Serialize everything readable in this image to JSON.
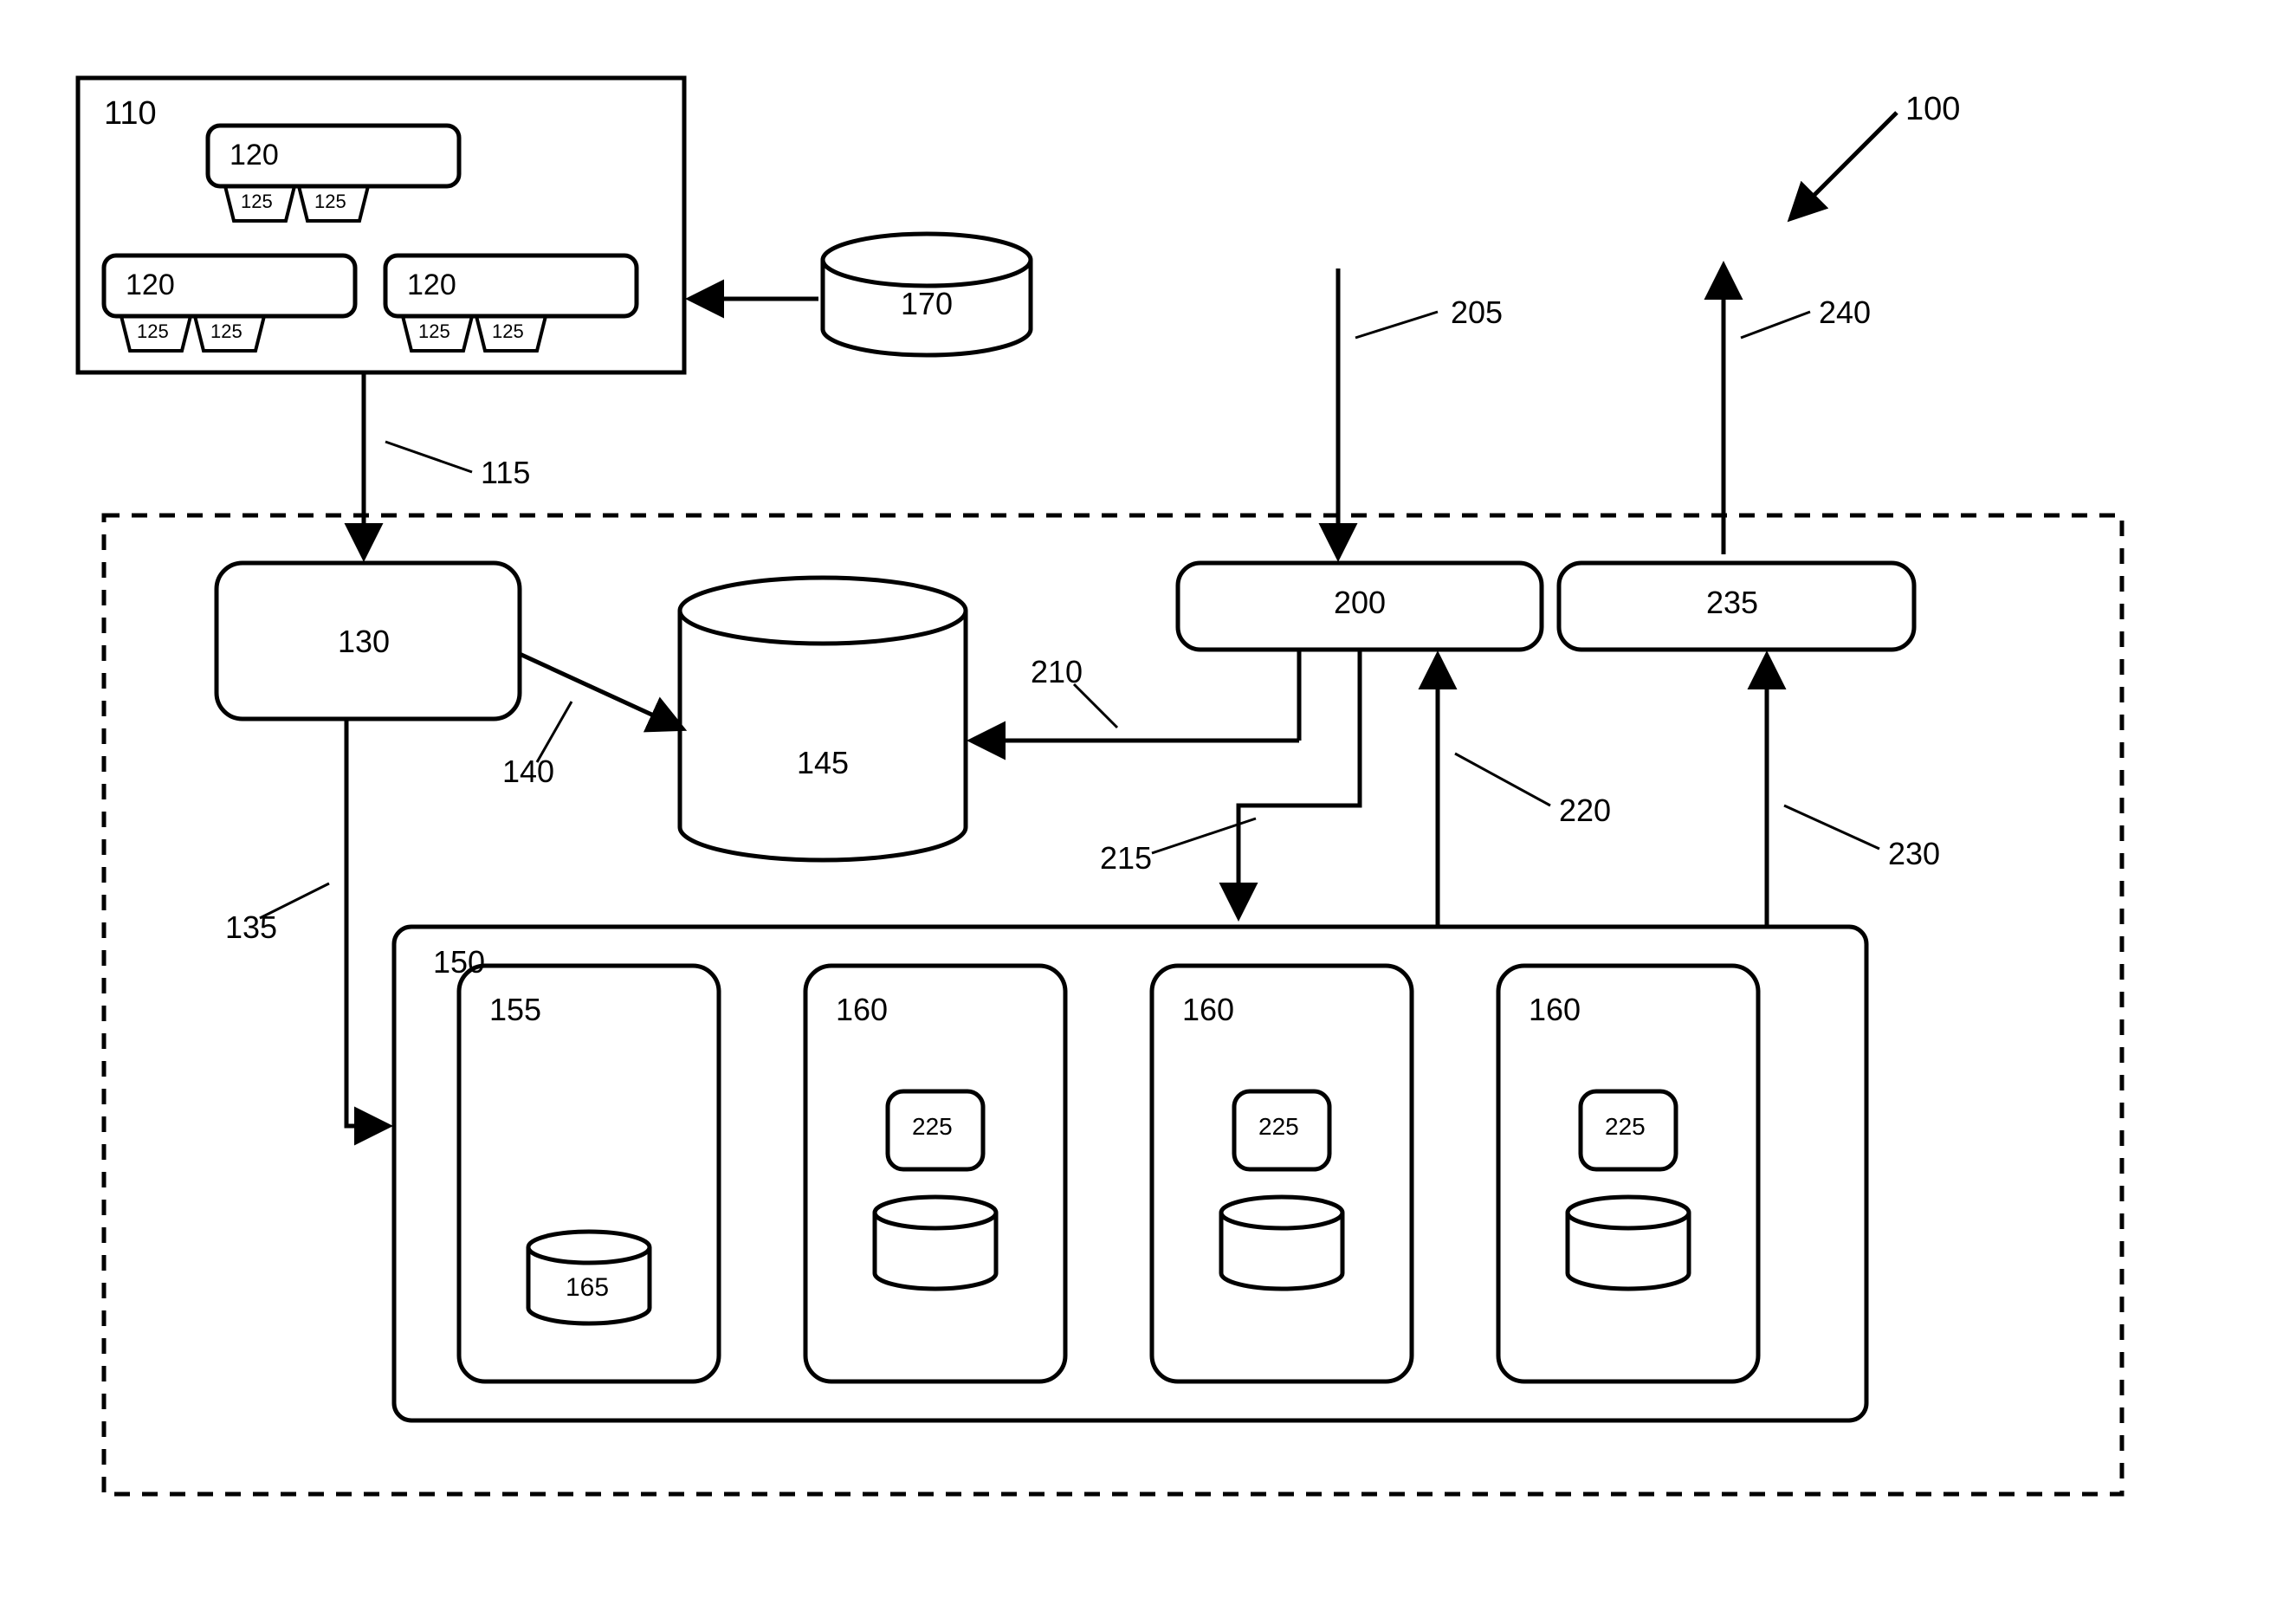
{
  "labels": {
    "n100": "100",
    "n110": "110",
    "n115": "115",
    "n120a": "120",
    "n120b": "120",
    "n120c": "120",
    "n125a": "125",
    "n125b": "125",
    "n125c": "125",
    "n125d": "125",
    "n125e": "125",
    "n125f": "125",
    "n130": "130",
    "n135": "135",
    "n140": "140",
    "n145": "145",
    "n150": "150",
    "n155": "155",
    "n160a": "160",
    "n160b": "160",
    "n160c": "160",
    "n165": "165",
    "n170": "170",
    "n200": "200",
    "n205": "205",
    "n210": "210",
    "n215": "215",
    "n220": "220",
    "n225a": "225",
    "n225b": "225",
    "n225c": "225",
    "n230": "230",
    "n235": "235",
    "n240": "240"
  },
  "diagram": {
    "type": "patent-block-diagram",
    "description": "System block diagram with numbered components, dashed boundary, cylinders (data stores), rounded rectangles (modules), and directed arrows."
  }
}
